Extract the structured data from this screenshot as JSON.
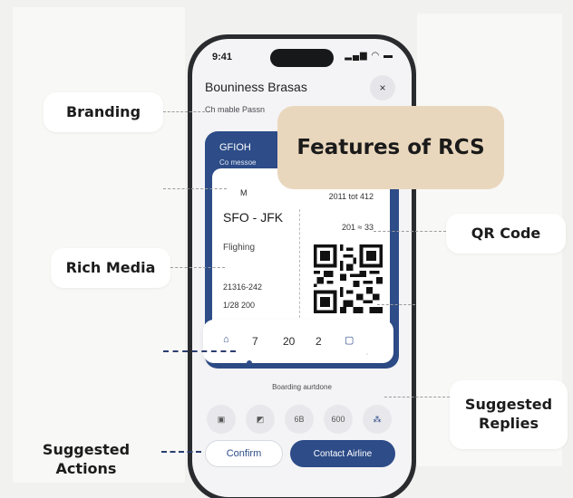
{
  "title": "Features of RCS",
  "callouts": {
    "branding": "Branding",
    "rich_media": "Rich Media",
    "qr_code": "QR Code",
    "suggested_replies": "Suggested Replies",
    "suggested_actions": "Suggested Actions"
  },
  "phone": {
    "status_time": "9:41",
    "status_icons": "signal-wifi-battery-icons",
    "brand_name": "Bouniness Brasas",
    "brand_subtitle": "Ch mable Passn",
    "close_label": "×",
    "pass": {
      "code": "GFIOH",
      "message": "Co messoe",
      "marker": "M",
      "number_top": "2011 tot 412",
      "number_mid": "201 ≈ 33",
      "route": "SFO - JFK",
      "status": "Flighing",
      "line1": "21316-242",
      "line2": "1/28 200"
    },
    "date_strip": {
      "day1": "7",
      "day2": "20",
      "day3": "2"
    },
    "boarding_label": "Boarding aurtdone",
    "replies": [
      "6B",
      "600"
    ],
    "confirm_label": "Confirm",
    "contact_label": "Contact Airline"
  },
  "colors": {
    "accent": "#2d4c88",
    "title_card": "#e9d7bd",
    "background": "#f1f1ef"
  }
}
